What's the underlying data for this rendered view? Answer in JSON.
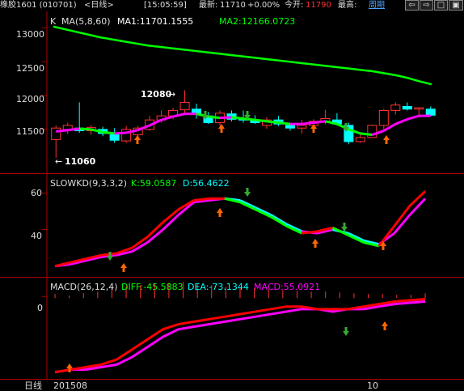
{
  "topbar": {
    "instrument": "橡胶1601 (010701)",
    "period_tag": "<日线>",
    "time": "[15:05:59]",
    "latest_label": "最新:",
    "latest_value": "11710",
    "change": "+0.00%",
    "open_label": "今开:",
    "open_value": "11790",
    "high_label": "最高:",
    "period_button": "周期",
    "nav_buttons": [
      "⇦",
      "⇨",
      "□",
      "▣"
    ]
  },
  "colors": {
    "up": "#ff3232",
    "down": "#00ffff",
    "ma1": "#ffffff",
    "ma2": "#00ff00",
    "axis": "#b00000",
    "k_line": "#ff0000",
    "d_line": "#ff00ff",
    "kd_alt": "#00ff00",
    "macd_dea": "#ff00ff",
    "arrow_up": "#ff6600",
    "arrow_down": "#33aa33"
  },
  "panel_price": {
    "prefix": "K",
    "title": "MA(5,8,60)",
    "ma1_label": "MA1:11701.1555",
    "ma2_label": "MA2:12166.0723",
    "y_ticks": [
      "13000",
      "12500",
      "12000",
      "11500"
    ],
    "annotation_high": "12080",
    "annotation_low": "11060"
  },
  "panel_kd": {
    "title": "SLOWKD(9,3,3,2)",
    "k_label": "K:59.0587",
    "d_label": "D:56.4622",
    "y_ticks": [
      "60",
      "40"
    ]
  },
  "panel_macd": {
    "title": "MACD(26,12,4)",
    "diff_label": "DIFF:-45.5883",
    "dea_label": "DEA:-73.1344",
    "macd_label": "MACD:55.0921",
    "y_ticks": [
      "0"
    ]
  },
  "bottom": {
    "period_label": "日线",
    "start_date": "201508",
    "mid_marker": "10"
  },
  "chart_data": {
    "type": "candlestick",
    "candles": [
      {
        "o": 11350,
        "h": 11560,
        "l": 11080,
        "c": 11520
      },
      {
        "o": 11500,
        "h": 11600,
        "l": 11430,
        "c": 11560
      },
      {
        "o": 11520,
        "h": 11900,
        "l": 11450,
        "c": 11480
      },
      {
        "o": 11480,
        "h": 11560,
        "l": 11420,
        "c": 11530
      },
      {
        "o": 11500,
        "h": 11540,
        "l": 11400,
        "c": 11440
      },
      {
        "o": 11450,
        "h": 11520,
        "l": 11300,
        "c": 11340
      },
      {
        "o": 11330,
        "h": 11550,
        "l": 11300,
        "c": 11500
      },
      {
        "o": 11420,
        "h": 11550,
        "l": 11380,
        "c": 11520
      },
      {
        "o": 11500,
        "h": 11700,
        "l": 11480,
        "c": 11640
      },
      {
        "o": 11640,
        "h": 11780,
        "l": 11600,
        "c": 11700
      },
      {
        "o": 11700,
        "h": 11820,
        "l": 11650,
        "c": 11780
      },
      {
        "o": 11790,
        "h": 12080,
        "l": 11740,
        "c": 11900
      },
      {
        "o": 11800,
        "h": 11880,
        "l": 11660,
        "c": 11720
      },
      {
        "o": 11700,
        "h": 11760,
        "l": 11580,
        "c": 11600
      },
      {
        "o": 11600,
        "h": 11780,
        "l": 11560,
        "c": 11740
      },
      {
        "o": 11730,
        "h": 11780,
        "l": 11620,
        "c": 11650
      },
      {
        "o": 11650,
        "h": 11780,
        "l": 11600,
        "c": 11640
      },
      {
        "o": 11640,
        "h": 11710,
        "l": 11580,
        "c": 11600
      },
      {
        "o": 11560,
        "h": 11680,
        "l": 11510,
        "c": 11640
      },
      {
        "o": 11640,
        "h": 11700,
        "l": 11550,
        "c": 11580
      },
      {
        "o": 11560,
        "h": 11600,
        "l": 11480,
        "c": 11520
      },
      {
        "o": 11520,
        "h": 11640,
        "l": 11440,
        "c": 11560
      },
      {
        "o": 11560,
        "h": 11650,
        "l": 11520,
        "c": 11620
      },
      {
        "o": 11620,
        "h": 11790,
        "l": 11580,
        "c": 11660
      },
      {
        "o": 11640,
        "h": 11740,
        "l": 11560,
        "c": 11580
      },
      {
        "o": 11560,
        "h": 11600,
        "l": 11280,
        "c": 11320
      },
      {
        "o": 11320,
        "h": 11430,
        "l": 11300,
        "c": 11380
      },
      {
        "o": 11380,
        "h": 11570,
        "l": 11380,
        "c": 11560
      },
      {
        "o": 11560,
        "h": 11800,
        "l": 11500,
        "c": 11780
      },
      {
        "o": 11780,
        "h": 11900,
        "l": 11720,
        "c": 11860
      },
      {
        "o": 11840,
        "h": 11900,
        "l": 11780,
        "c": 11800
      },
      {
        "o": 11800,
        "h": 11830,
        "l": 11700,
        "c": 11820
      },
      {
        "o": 11800,
        "h": 11840,
        "l": 11700,
        "c": 11710
      }
    ],
    "ma60": [
      13020,
      12980,
      12940,
      12900,
      12860,
      12830,
      12800,
      12770,
      12740,
      12720,
      12700,
      12680,
      12660,
      12640,
      12620,
      12600,
      12580,
      12560,
      12540,
      12520,
      12500,
      12480,
      12460,
      12440,
      12420,
      12400,
      12380,
      12360,
      12330,
      12300,
      12260,
      12210,
      12166
    ],
    "ma_short": [
      11470,
      11490,
      11510,
      11500,
      11460,
      11440,
      11450,
      11490,
      11560,
      11640,
      11690,
      11730,
      11730,
      11690,
      11670,
      11680,
      11660,
      11640,
      11620,
      11600,
      11580,
      11580,
      11600,
      11620,
      11580,
      11500,
      11440,
      11420,
      11480,
      11580,
      11650,
      11700,
      11701
    ],
    "kd_k": [
      20,
      22,
      24,
      26,
      27,
      30,
      36,
      44,
      51,
      56,
      57,
      57,
      55,
      51,
      47,
      42,
      38,
      39,
      41,
      37,
      33,
      31,
      42,
      53,
      61
    ],
    "kd_d": [
      20,
      21,
      23,
      25,
      26,
      28,
      33,
      40,
      48,
      55,
      56,
      57,
      56,
      52,
      48,
      43,
      39,
      38,
      40,
      38,
      34,
      32,
      38,
      48,
      57
    ],
    "macd_bars": [
      5,
      3,
      6,
      8,
      12,
      15,
      16,
      18,
      19,
      20,
      18,
      16,
      14,
      13,
      12,
      11,
      10,
      9,
      8,
      8,
      7,
      6,
      5,
      5,
      4,
      4,
      6
    ],
    "macd_diff": [
      -30,
      -29,
      -28,
      -27,
      -25,
      -21,
      -17,
      -13,
      -11,
      -10,
      -9,
      -8,
      -7,
      -6,
      -5,
      -4,
      -4,
      -5,
      -5,
      -5,
      -4,
      -3,
      -2,
      -1.5,
      -1
    ],
    "macd_dea": [
      -30,
      -29,
      -29,
      -28,
      -27,
      -24,
      -20,
      -16,
      -13,
      -12,
      -11,
      -10,
      -9,
      -8,
      -7,
      -6,
      -5,
      -5,
      -6,
      -5,
      -5,
      -4,
      -3,
      -2.5,
      -2
    ],
    "price_ylim": [
      10900,
      13150
    ],
    "kd_ylim": [
      15,
      66
    ],
    "macd_ylim": [
      -32,
      2
    ]
  }
}
